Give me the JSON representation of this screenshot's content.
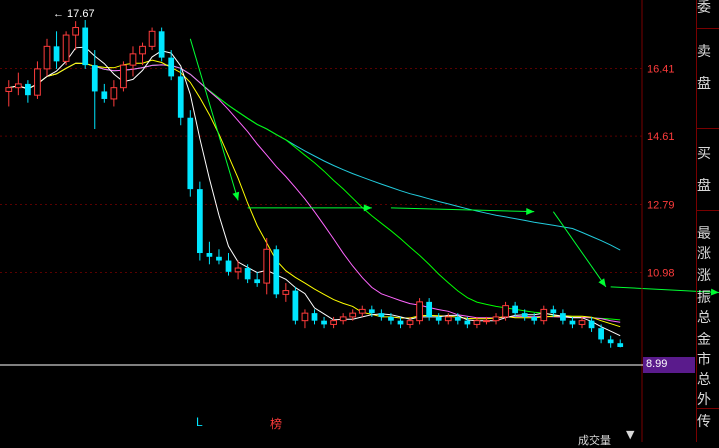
{
  "chart_data": {
    "type": "candlestick",
    "high_marker": "17.67",
    "y_ticks": [
      "16.41",
      "14.61",
      "12.79",
      "10.98"
    ],
    "current_price": "8.99",
    "ylim": [
      8.6,
      18.1
    ],
    "candles": [
      [
        15.8,
        16.1,
        15.4,
        15.9
      ],
      [
        15.9,
        16.3,
        15.7,
        16.0
      ],
      [
        16.0,
        16.1,
        15.5,
        15.7
      ],
      [
        15.7,
        16.6,
        15.6,
        16.4
      ],
      [
        16.4,
        17.2,
        16.2,
        17.0
      ],
      [
        17.0,
        17.4,
        16.4,
        16.6
      ],
      [
        16.6,
        17.4,
        16.5,
        17.3
      ],
      [
        17.3,
        17.67,
        16.9,
        17.5
      ],
      [
        17.5,
        17.7,
        16.4,
        16.5
      ],
      [
        16.5,
        16.9,
        14.8,
        15.8
      ],
      [
        15.8,
        16.0,
        15.5,
        15.6
      ],
      [
        15.6,
        16.1,
        15.4,
        15.9
      ],
      [
        15.9,
        16.6,
        15.8,
        16.5
      ],
      [
        16.5,
        17.0,
        16.2,
        16.8
      ],
      [
        16.8,
        17.1,
        16.5,
        17.0
      ],
      [
        17.0,
        17.5,
        16.9,
        17.4
      ],
      [
        17.4,
        17.5,
        16.6,
        16.7
      ],
      [
        16.7,
        16.9,
        16.1,
        16.2
      ],
      [
        16.2,
        16.4,
        14.9,
        15.1
      ],
      [
        15.1,
        15.3,
        13.0,
        13.2
      ],
      [
        13.2,
        13.4,
        11.3,
        11.5
      ],
      [
        11.5,
        11.8,
        11.2,
        11.4
      ],
      [
        11.4,
        11.6,
        11.2,
        11.3
      ],
      [
        11.3,
        11.5,
        10.9,
        11.0
      ],
      [
        11.0,
        11.3,
        10.8,
        11.1
      ],
      [
        11.1,
        11.2,
        10.7,
        10.8
      ],
      [
        10.8,
        11.0,
        10.6,
        10.7
      ],
      [
        10.7,
        11.9,
        10.4,
        11.6
      ],
      [
        11.6,
        11.7,
        10.3,
        10.4
      ],
      [
        10.4,
        10.7,
        10.2,
        10.5
      ],
      [
        10.5,
        10.6,
        9.6,
        9.7
      ],
      [
        9.7,
        10.0,
        9.5,
        9.9
      ],
      [
        9.9,
        10.0,
        9.6,
        9.7
      ],
      [
        9.7,
        9.8,
        9.5,
        9.6
      ],
      [
        9.6,
        9.8,
        9.5,
        9.7
      ],
      [
        9.7,
        9.9,
        9.6,
        9.8
      ],
      [
        9.8,
        10.0,
        9.7,
        9.9
      ],
      [
        9.9,
        10.1,
        9.8,
        10.0
      ],
      [
        10.0,
        10.1,
        9.8,
        9.9
      ],
      [
        9.9,
        10.0,
        9.7,
        9.8
      ],
      [
        9.8,
        9.9,
        9.6,
        9.7
      ],
      [
        9.7,
        9.8,
        9.5,
        9.6
      ],
      [
        9.6,
        9.8,
        9.5,
        9.7
      ],
      [
        9.7,
        10.3,
        9.6,
        10.2
      ],
      [
        10.2,
        10.3,
        9.7,
        9.8
      ],
      [
        9.8,
        9.9,
        9.6,
        9.7
      ],
      [
        9.7,
        9.9,
        9.6,
        9.8
      ],
      [
        9.8,
        9.9,
        9.6,
        9.7
      ],
      [
        9.7,
        9.8,
        9.5,
        9.6
      ],
      [
        9.6,
        9.8,
        9.5,
        9.7
      ],
      [
        9.7,
        9.8,
        9.6,
        9.7
      ],
      [
        9.7,
        9.9,
        9.6,
        9.8
      ],
      [
        9.8,
        10.2,
        9.7,
        10.1
      ],
      [
        10.1,
        10.2,
        9.8,
        9.9
      ],
      [
        9.9,
        10.0,
        9.7,
        9.8
      ],
      [
        9.8,
        9.9,
        9.6,
        9.7
      ],
      [
        9.7,
        10.1,
        9.6,
        10.0
      ],
      [
        10.0,
        10.1,
        9.8,
        9.9
      ],
      [
        9.9,
        10.0,
        9.6,
        9.7
      ],
      [
        9.7,
        9.8,
        9.5,
        9.6
      ],
      [
        9.6,
        9.8,
        9.5,
        9.7
      ],
      [
        9.7,
        9.8,
        9.4,
        9.5
      ],
      [
        9.5,
        9.6,
        9.1,
        9.2
      ],
      [
        9.2,
        9.3,
        8.98,
        9.1
      ],
      [
        9.1,
        9.2,
        8.99,
        9.0
      ]
    ],
    "colors": {
      "up": "#ff3c3c",
      "down": "#00e6ff",
      "ma5": "#ffffff",
      "ma10": "#ffff00",
      "ma20": "#ff66ff",
      "ma30": "#00ff00",
      "ma60": "#22ccdd",
      "arrow": "#00ff33",
      "current_line": "#ffffff"
    },
    "markers": [
      "L",
      "榜"
    ]
  },
  "side_panel": {
    "chars": [
      "委",
      "卖",
      "盘",
      "买",
      "盘",
      "最",
      "涨",
      "涨",
      "振",
      "总",
      "金",
      "市",
      "总",
      "外",
      "传"
    ]
  },
  "bottom": {
    "tab_label": "成交量",
    "arrow": "▼"
  }
}
